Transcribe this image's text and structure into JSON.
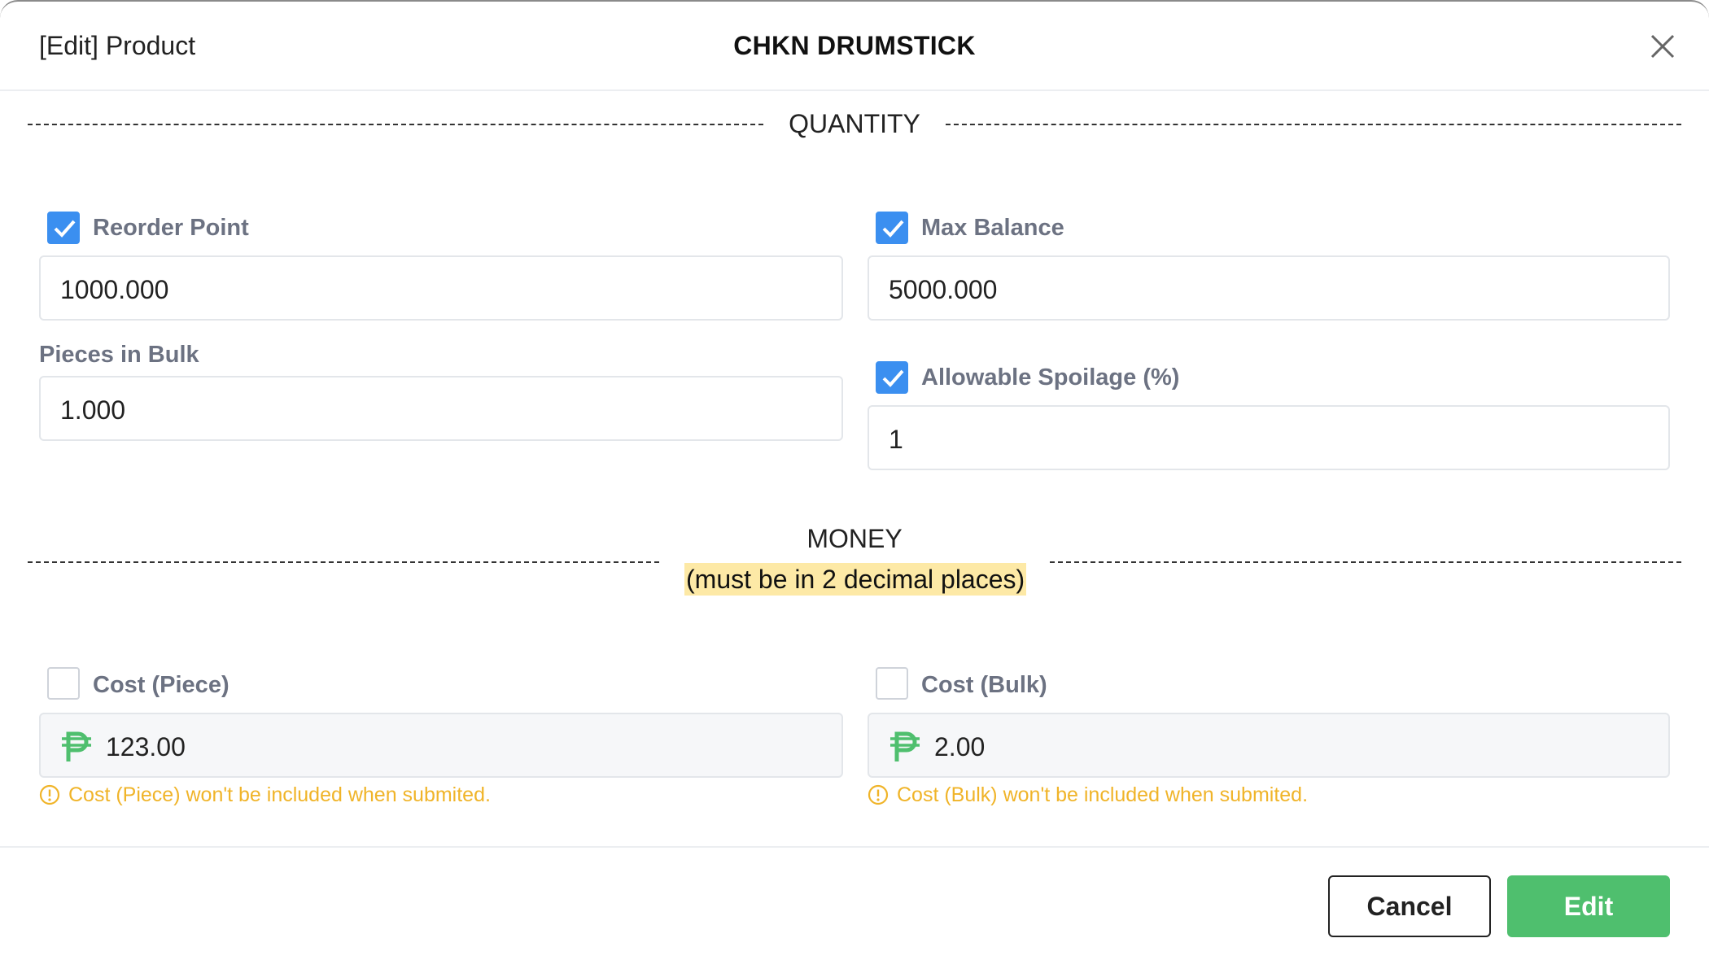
{
  "header": {
    "left_label": "[Edit] Product",
    "title": "CHKN DRUMSTICK"
  },
  "quantity": {
    "title": "QUANTITY",
    "reorder_point": {
      "label": "Reorder Point",
      "checked": true,
      "value": "1000.000"
    },
    "max_balance": {
      "label": "Max Balance",
      "checked": true,
      "value": "5000.000"
    },
    "pieces_in_bulk": {
      "label": "Pieces in Bulk",
      "value": "1.000"
    },
    "allowable_spoilage": {
      "label": "Allowable Spoilage (%)",
      "checked": true,
      "value": "1"
    }
  },
  "money": {
    "title": "MONEY",
    "note": "(must be in 2 decimal places)",
    "cost_piece": {
      "label": "Cost (Piece)",
      "checked": false,
      "currency": "₱",
      "value": "123.00",
      "warning": "Cost (Piece) won't be included when submited."
    },
    "cost_bulk": {
      "label": "Cost (Bulk)",
      "checked": false,
      "currency": "₱",
      "value": "2.00",
      "warning": "Cost (Bulk) won't be included when submited."
    }
  },
  "footer": {
    "cancel_label": "Cancel",
    "edit_label": "Edit"
  },
  "colors": {
    "checkbox_checked": "#3b8ff0",
    "peso": "#4fbf6e",
    "warning": "#f0b429",
    "note_highlight": "#fde9a6",
    "edit_button": "#4fbf6e"
  },
  "icons": {
    "close": "close-icon",
    "check": "check-icon",
    "currency": "peso-icon",
    "warning": "warning-circle-icon"
  }
}
